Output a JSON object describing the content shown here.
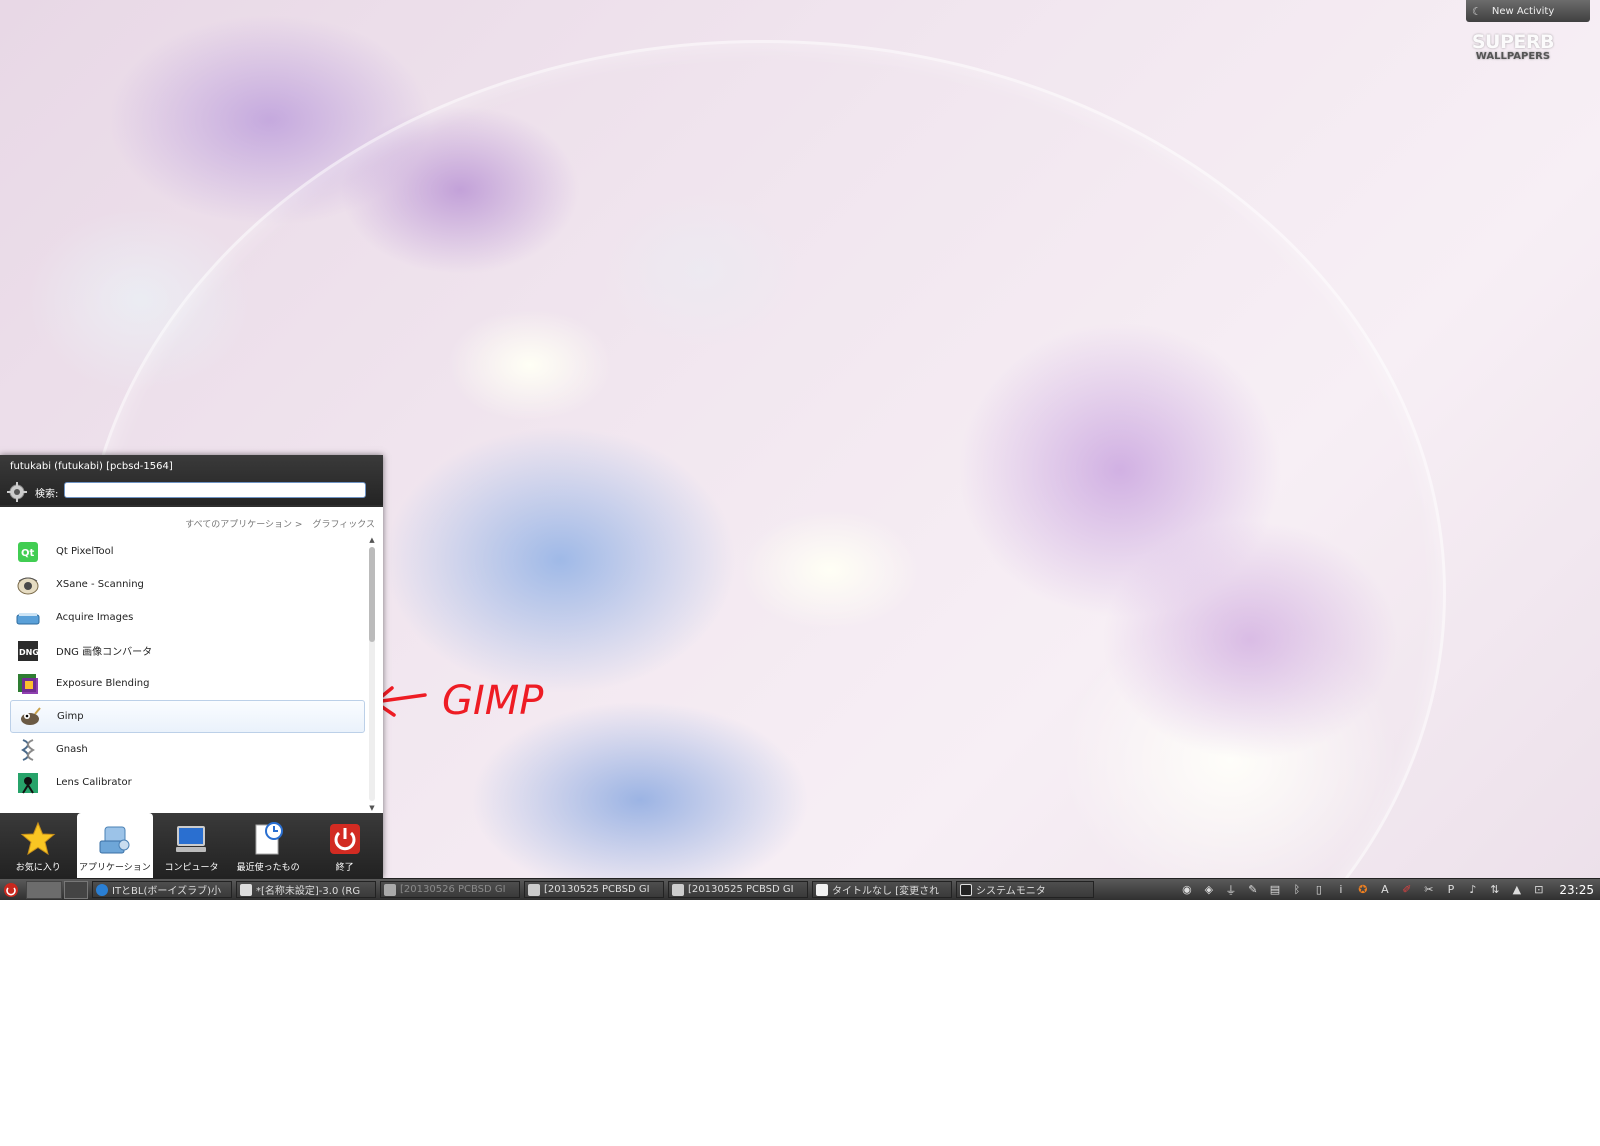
{
  "desktop": {
    "activity_button": "New Activity",
    "logo_line1": "SUPERB",
    "logo_line2": "WALLPAPERS",
    "annotation_text": "GIMP"
  },
  "menu": {
    "user_label": "futukabi (futukabi) [pcbsd-1564]",
    "search_label": "検索:",
    "search_value": "",
    "breadcrumb": [
      "すべてのアプリケーション >",
      "グラフィックス"
    ],
    "apps": [
      {
        "label": "Qt PixelTool",
        "icon": "qt-icon"
      },
      {
        "label": "XSane - Scanning",
        "icon": "xsane-icon"
      },
      {
        "label": "Acquire Images",
        "icon": "scanner-icon"
      },
      {
        "label": "DNG 画像コンバータ",
        "icon": "dng-icon"
      },
      {
        "label": "Exposure Blending",
        "icon": "exposure-icon"
      },
      {
        "label": "Gimp",
        "icon": "gimp-icon",
        "selected": true
      },
      {
        "label": "Gnash",
        "icon": "gnash-icon"
      },
      {
        "label": "Lens Calibrator",
        "icon": "lens-icon"
      }
    ],
    "tabs": [
      {
        "label": "お気に入り",
        "icon": "star-icon"
      },
      {
        "label": "アプリケーション",
        "icon": "applications-icon",
        "active": true
      },
      {
        "label": "コンピュータ",
        "icon": "computer-icon"
      },
      {
        "label": "最近使ったもの",
        "icon": "recent-icon"
      },
      {
        "label": "終了",
        "icon": "power-icon"
      }
    ]
  },
  "taskbar": {
    "tasks": [
      {
        "label": "ITとBL(ボーイズラブ)小",
        "dim": false
      },
      {
        "label": "*[名称未設定]-3.0 (RG",
        "dim": false
      },
      {
        "label": "[20130526 PCBSD GI",
        "dim": true
      },
      {
        "label": "[20130525 PCBSD GI",
        "dim": false
      },
      {
        "label": "[20130525 PCBSD GI",
        "dim": false
      },
      {
        "label": "タイトルなし [変更され",
        "dim": false
      },
      {
        "label": "システムモニタ",
        "dim": false
      }
    ],
    "clock": "23:25"
  },
  "colors": {
    "taskbar_bg": "#3a3a3a",
    "menu_bg": "#2e2e2e",
    "annotation": "#ee1c24",
    "selection_border": "#bcd0e8"
  }
}
